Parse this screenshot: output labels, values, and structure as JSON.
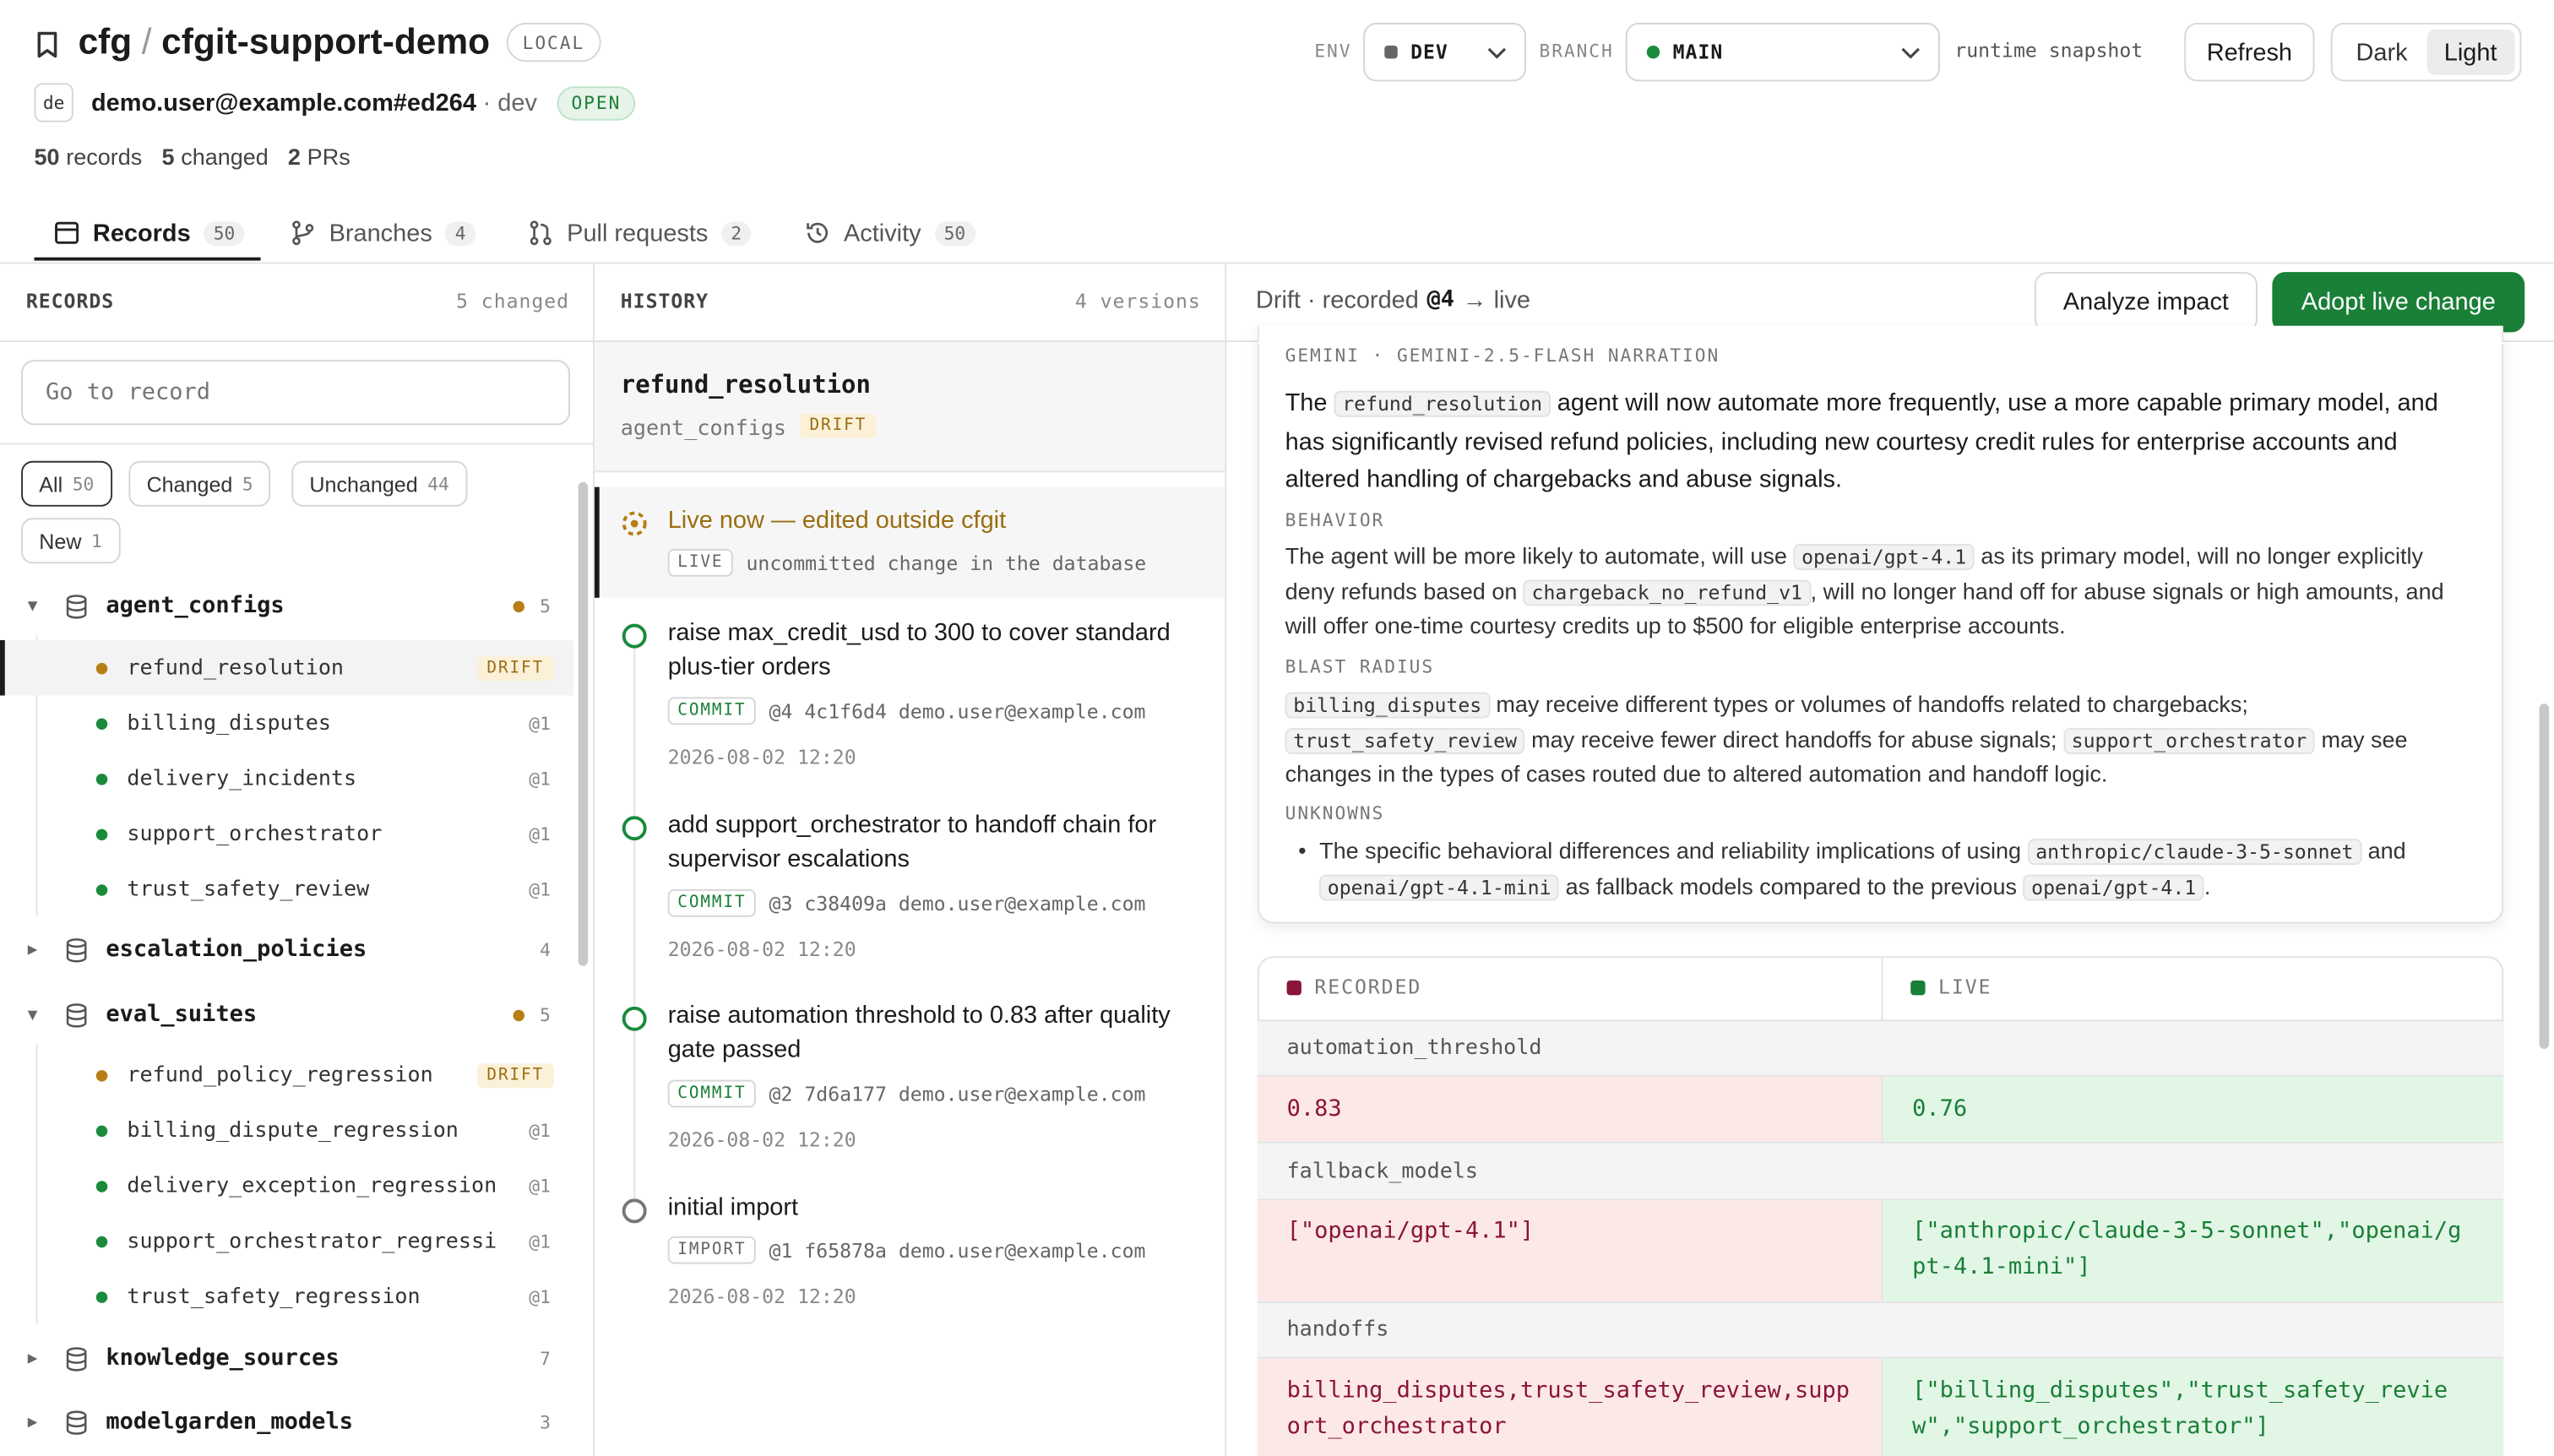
{
  "header": {
    "owner": "cfg",
    "sep": "/",
    "repo": "cfgit-support-demo",
    "repo_badge": "LOCAL",
    "avatar": "de",
    "user": "demo.user@example.com#ed264",
    "user_env": "· dev",
    "status": "OPEN",
    "stats": {
      "records_n": "50",
      "records_l": "records",
      "changed_n": "5",
      "changed_l": "changed",
      "prs_n": "2",
      "prs_l": "PRs"
    }
  },
  "toolbar": {
    "env_label": "ENV",
    "env_value": "DEV",
    "branch_label": "BRANCH",
    "branch_value": "MAIN",
    "snapshot": "runtime snapshot",
    "refresh": "Refresh",
    "dark": "Dark",
    "light": "Light"
  },
  "tabs": [
    {
      "label": "Records",
      "count": "50"
    },
    {
      "label": "Branches",
      "count": "4"
    },
    {
      "label": "Pull requests",
      "count": "2"
    },
    {
      "label": "Activity",
      "count": "50"
    }
  ],
  "records": {
    "title": "RECORDS",
    "changed": "5 changed",
    "search_placeholder": "Go to record",
    "filters": [
      {
        "label": "All",
        "count": "50"
      },
      {
        "label": "Changed",
        "count": "5"
      },
      {
        "label": "Unchanged",
        "count": "44"
      },
      {
        "label": "New",
        "count": "1"
      }
    ],
    "groups": [
      {
        "name": "agent_configs",
        "count": "5",
        "items": [
          {
            "name": "refund_resolution",
            "tag": "DRIFT"
          },
          {
            "name": "billing_disputes",
            "tag": "@1"
          },
          {
            "name": "delivery_incidents",
            "tag": "@1"
          },
          {
            "name": "support_orchestrator",
            "tag": "@1"
          },
          {
            "name": "trust_safety_review",
            "tag": "@1"
          }
        ]
      },
      {
        "name": "escalation_policies",
        "count": "4"
      },
      {
        "name": "eval_suites",
        "count": "5",
        "items": [
          {
            "name": "refund_policy_regression",
            "tag": "DRIFT"
          },
          {
            "name": "billing_dispute_regression",
            "tag": "@1"
          },
          {
            "name": "delivery_exception_regression",
            "tag": "@1"
          },
          {
            "name": "support_orchestrator_regressi",
            "tag": "@1"
          },
          {
            "name": "trust_safety_regression",
            "tag": "@1"
          }
        ]
      },
      {
        "name": "knowledge_sources",
        "count": "7"
      },
      {
        "name": "modelgarden_models",
        "count": "3"
      }
    ]
  },
  "history": {
    "title": "HISTORY",
    "versions": "4 versions",
    "record": "refund_resolution",
    "table": "agent_configs",
    "tag": "DRIFT",
    "live": {
      "title": "Live now — edited outside cfgit",
      "badge": "LIVE",
      "desc": "uncommitted change in the database"
    },
    "commits": [
      {
        "title": "raise max_credit_usd to 300 to cover standard plus-tier orders",
        "badge": "COMMIT",
        "ver": "@4",
        "hash": "4c1f6d4",
        "author": "demo.user@example.com",
        "date": "2026-08-02 12:20"
      },
      {
        "title": "add support_orchestrator to handoff chain for supervisor escalations",
        "badge": "COMMIT",
        "ver": "@3",
        "hash": "c38409a",
        "author": "demo.user@example.com",
        "date": "2026-08-02 12:20"
      },
      {
        "title": "raise automation threshold to 0.83 after quality gate passed",
        "badge": "COMMIT",
        "ver": "@2",
        "hash": "7d6a177",
        "author": "demo.user@example.com",
        "date": "2026-08-02 12:20"
      },
      {
        "title": "initial import",
        "badge": "IMPORT",
        "ver": "@1",
        "hash": "f65878a",
        "author": "demo.user@example.com",
        "date": "2026-08-02 12:20"
      }
    ]
  },
  "drift": {
    "head_prefix": "Drift · recorded",
    "head_ver": "@4",
    "head_suffix": "→ live",
    "analyze": "Analyze impact",
    "adopt": "Adopt live change",
    "narration_label": "GEMINI · GEMINI-2.5-FLASH NARRATION",
    "summary_a": "The",
    "summary_code": "refund_resolution",
    "summary_b": "agent will now automate more frequently, use a more capable primary model, and has significantly revised refund policies, including new courtesy credit rules for enterprise accounts and altered handling of chargebacks and abuse signals.",
    "behavior_label": "BEHAVIOR",
    "behavior_a": "The agent will be more likely to automate, will use",
    "behavior_code1": "openai/gpt-4.1",
    "behavior_b": "as its primary model, will no longer explicitly deny refunds based on",
    "behavior_code2": "chargeback_no_refund_v1",
    "behavior_c": ", will no longer hand off for abuse signals or high amounts, and will offer one-time courtesy credits up to $500 for eligible enterprise accounts.",
    "blast_label": "BLAST RADIUS",
    "blast_code1": "billing_disputes",
    "blast_a": "may receive different types or volumes of handoffs related to chargebacks;",
    "blast_code2": "trust_safety_review",
    "blast_b": "may receive fewer direct handoffs for abuse signals;",
    "blast_code3": "support_orchestrator",
    "blast_c": "may see changes in the types of cases routed due to altered automation and handoff logic.",
    "unknowns_label": "UNKNOWNS",
    "unk_a": "The specific behavioral differences and reliability implications of using",
    "unk_code1": "anthropic/claude-3-5-sonnet",
    "unk_b": "and",
    "unk_code2": "openai/gpt-4.1-mini",
    "unk_c": "as fallback models compared to the previous",
    "unk_code3": "openai/gpt-4.1",
    "unk_d": "."
  },
  "diff": {
    "recorded_label": "RECORDED",
    "live_label": "LIVE",
    "rows": [
      {
        "field": "automation_threshold",
        "recorded": "0.83",
        "live": "0.76"
      },
      {
        "field": "fallback_models",
        "recorded": "[\"openai/gpt-4.1\"]",
        "live": "[\"anthropic/claude-3-5-sonnet\",\"openai/gpt-4.1-mini\"]"
      },
      {
        "field": "handoffs",
        "recorded": "billing_disputes,trust_safety_review,support_orchestrator",
        "live": "[\"billing_disputes\",\"trust_safety_review\",\"support_orchestrator\"]"
      }
    ]
  },
  "colors": {
    "accent": "#1a7f37",
    "drift": "#b87d14",
    "recorded": "#8a1538",
    "live": "#1a7f37"
  }
}
